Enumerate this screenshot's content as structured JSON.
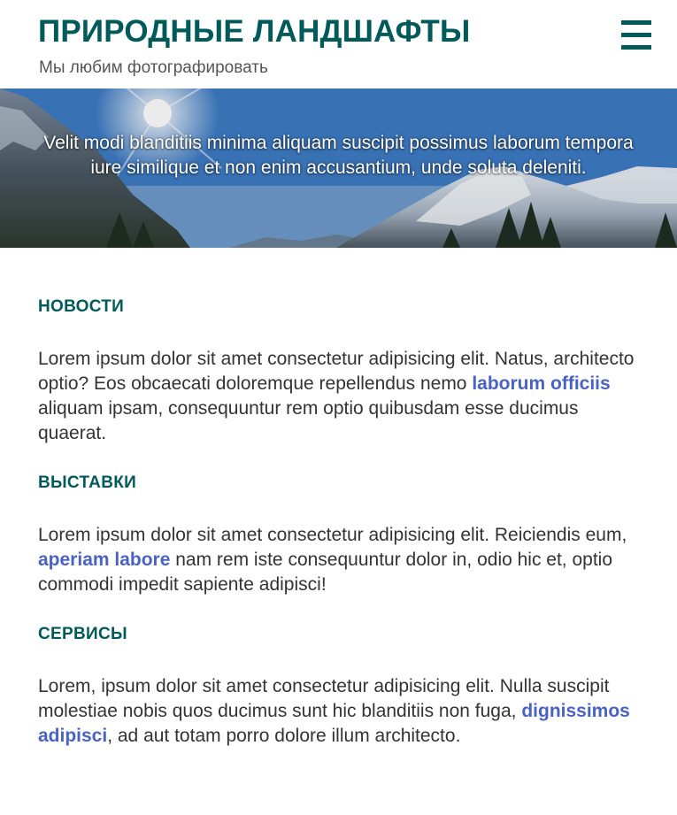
{
  "header": {
    "title": "ПРИРОДНЫЕ ЛАНДШАФТЫ",
    "subtitle": "Мы любим фотографировать",
    "menu_icon": "hamburger-menu-icon"
  },
  "hero": {
    "text": "Velit modi blanditiis minima aliquam suscipit possimus laborum tempora iure similique et non enim accusantium, unde soluta deleniti."
  },
  "sections": [
    {
      "heading": "НОВОСТИ",
      "text_before": "Lorem ipsum dolor sit amet consectetur adipisicing elit. Natus, architecto optio? Eos obcaecati doloremque repellendus nemo ",
      "link": "laborum officiis",
      "text_after": " aliquam ipsam, consequuntur rem optio quibusdam esse ducimus quaerat."
    },
    {
      "heading": "ВЫСТАВКИ",
      "text_before": "Lorem ipsum dolor sit amet consectetur adipisicing elit. Reiciendis eum, ",
      "link": "aperiam labore",
      "text_after": " nam rem iste consequuntur dolor in, odio hic et, optio commodi impedit sapiente adipisci!"
    },
    {
      "heading": "СЕРВИСЫ",
      "text_before": "Lorem, ipsum dolor sit amet consectetur adipisicing elit. Nulla suscipit molestiae nobis quos ducimus sunt hic blanditiis non fuga, ",
      "link": "dignissimos adipisci",
      "text_after": ", ad aut totam porro dolore illum architecto."
    }
  ],
  "colors": {
    "brand": "#005a5a",
    "link": "#4a62c4",
    "body_text": "#333333",
    "subtitle": "#555555"
  }
}
